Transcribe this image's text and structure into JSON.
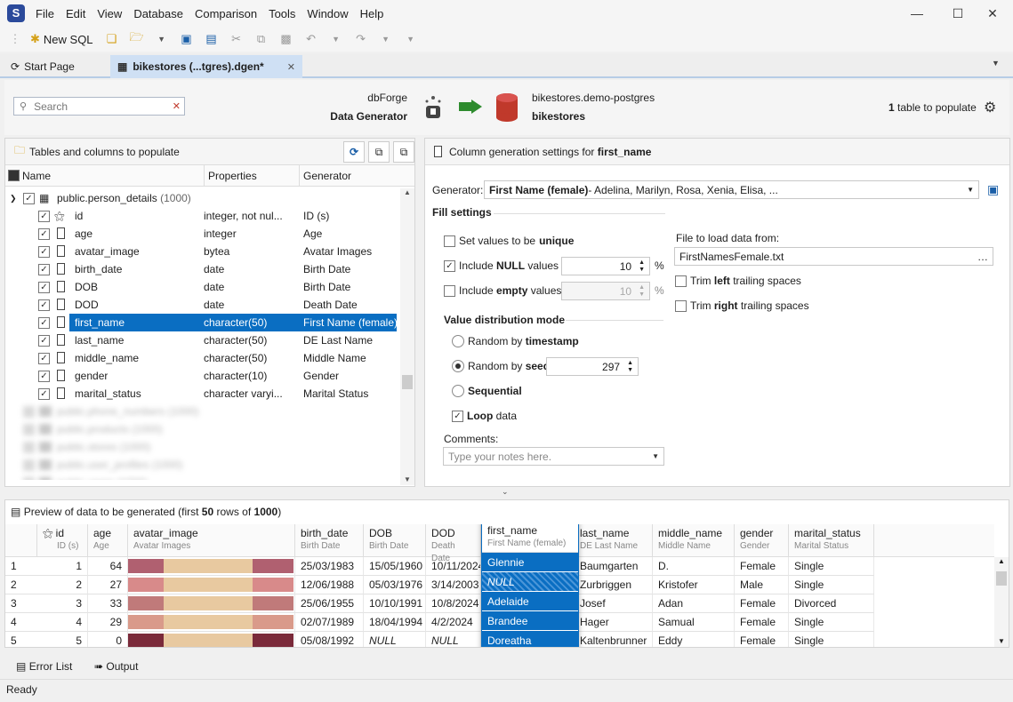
{
  "menubar": {
    "logo": "S",
    "items": [
      "File",
      "Edit",
      "View",
      "Database",
      "Comparison",
      "Tools",
      "Window",
      "Help"
    ]
  },
  "toolbar": {
    "new_sql": "New SQL"
  },
  "tabs": [
    {
      "label": "Start Page"
    },
    {
      "label": "bikestores (...tgres).dgen*"
    }
  ],
  "header": {
    "search_placeholder": "Search",
    "source_title": "dbForge",
    "source_name": "Data Generator",
    "target_server": "bikestores.demo-postgres",
    "target_db": "bikestores",
    "populate_count": "1",
    "populate_text": "table to populate"
  },
  "left_panel": {
    "title": "Tables and columns to populate",
    "columns": [
      "Name",
      "Properties",
      "Generator"
    ],
    "table": {
      "name": "public.person_details",
      "count": "(1000)"
    },
    "rows": [
      {
        "name": "id",
        "props": "integer, not nul...",
        "gen": "ID (s)"
      },
      {
        "name": "age",
        "props": "integer",
        "gen": "Age"
      },
      {
        "name": "avatar_image",
        "props": "bytea",
        "gen": "Avatar Images"
      },
      {
        "name": "birth_date",
        "props": "date",
        "gen": "Birth Date"
      },
      {
        "name": "DOB",
        "props": "date",
        "gen": "Birth Date"
      },
      {
        "name": "DOD",
        "props": "date",
        "gen": "Death Date"
      },
      {
        "name": "first_name",
        "props": "character(50)",
        "gen": "First Name (female)"
      },
      {
        "name": "last_name",
        "props": "character(50)",
        "gen": "DE Last Name"
      },
      {
        "name": "middle_name",
        "props": "character(50)",
        "gen": "Middle Name"
      },
      {
        "name": "gender",
        "props": "character(10)",
        "gen": "Gender"
      },
      {
        "name": "marital_status",
        "props": "character varyi...",
        "gen": "Marital Status"
      }
    ],
    "blurred": [
      "public.phone_numbers (1000)",
      "public.products (1000)",
      "public.stores (1000)",
      "public.user_profiles (1000)",
      "public.users (1000)"
    ]
  },
  "right_panel": {
    "title_prefix": "Column generation settings for",
    "title_col": "first_name",
    "generator_label": "Generator:",
    "generator_name": "First Name (female)",
    "generator_desc": " - Adelina, Marilyn, Rosa, Xenia, Elisa, ...",
    "fill_settings": "Fill settings",
    "unique_prefix": "Set values to be ",
    "unique_bold": "unique",
    "null_prefix": "Include ",
    "null_bold": "NULL",
    "null_suffix": " values",
    "null_value": "10",
    "empty_prefix": "Include ",
    "empty_bold": "empty",
    "empty_suffix": " values",
    "empty_value": "10",
    "percent": "%",
    "file_label": "File to load data from:",
    "file_value": "FirstNamesFemale.txt",
    "trim_left_prefix": "Trim ",
    "trim_left_bold": "left",
    "trim_left_suffix": " trailing spaces",
    "trim_right_prefix": "Trim ",
    "trim_right_bold": "right",
    "trim_right_suffix": " trailing spaces",
    "dist_title": "Value distribution mode",
    "random_ts_prefix": "Random by ",
    "random_ts_bold": "timestamp",
    "random_seed_prefix": "Random by ",
    "random_seed_bold": "seed",
    "seed_value": "297",
    "sequential": "Sequential",
    "loop": "Loop",
    "loop_suffix": " data",
    "comments_label": "Comments:",
    "comments_placeholder": "Type your notes here."
  },
  "preview": {
    "title_prefix": "Preview of data to be generated (first ",
    "rows": "50",
    "title_mid": " rows of ",
    "total": "1000",
    "title_end": ")",
    "columns": [
      {
        "name": "id",
        "sub": "ID (s)"
      },
      {
        "name": "age",
        "sub": "Age"
      },
      {
        "name": "avatar_image",
        "sub": "Avatar Images"
      },
      {
        "name": "birth_date",
        "sub": "Birth Date"
      },
      {
        "name": "DOB",
        "sub": "Birth Date"
      },
      {
        "name": "DOD",
        "sub": "Death Date"
      },
      {
        "name": "first_name",
        "sub": "First Name (female)"
      },
      {
        "name": "last_name",
        "sub": "DE Last Name"
      },
      {
        "name": "middle_name",
        "sub": "Middle Name"
      },
      {
        "name": "gender",
        "sub": "Gender"
      },
      {
        "name": "marital_status",
        "sub": "Marital Status"
      }
    ],
    "data": [
      {
        "n": "1",
        "id": "1",
        "age": "64",
        "birth": "25/03/1983",
        "dob": "15/05/1960",
        "dod": "10/11/2024",
        "first": "Glennie",
        "last": "Baumgarten",
        "middle": "D.",
        "gender": "Female",
        "marital": "Single"
      },
      {
        "n": "2",
        "id": "2",
        "age": "27",
        "birth": "12/06/1988",
        "dob": "05/03/1976",
        "dod": "3/14/2003",
        "first": "NULL",
        "last": "Zurbriggen",
        "middle": "Kristofer",
        "gender": "Male",
        "marital": "Single"
      },
      {
        "n": "3",
        "id": "3",
        "age": "33",
        "birth": "25/06/1955",
        "dob": "10/10/1991",
        "dod": "10/8/2024",
        "first": "Adelaide",
        "last": "Josef",
        "middle": "Adan",
        "gender": "Female",
        "marital": "Divorced"
      },
      {
        "n": "4",
        "id": "4",
        "age": "29",
        "birth": "02/07/1989",
        "dob": "18/04/1994",
        "dod": "4/2/2024",
        "first": "Brandee",
        "last": "Hager",
        "middle": "Samual",
        "gender": "Female",
        "marital": "Single"
      },
      {
        "n": "5",
        "id": "5",
        "age": "0",
        "birth": "05/08/1992",
        "dob": "NULL",
        "dod": "NULL",
        "first": "Doreatha",
        "last": "Kaltenbrunner",
        "middle": "Eddy",
        "gender": "Female",
        "marital": "Single"
      }
    ]
  },
  "bottom": {
    "error_list": "Error List",
    "output": "Output",
    "status": "Ready"
  },
  "colors": {
    "accent": "#0a6ec2",
    "tab_active": "#cfe0f4",
    "arrow": "#2e8b2e",
    "db": "#c0392b"
  }
}
